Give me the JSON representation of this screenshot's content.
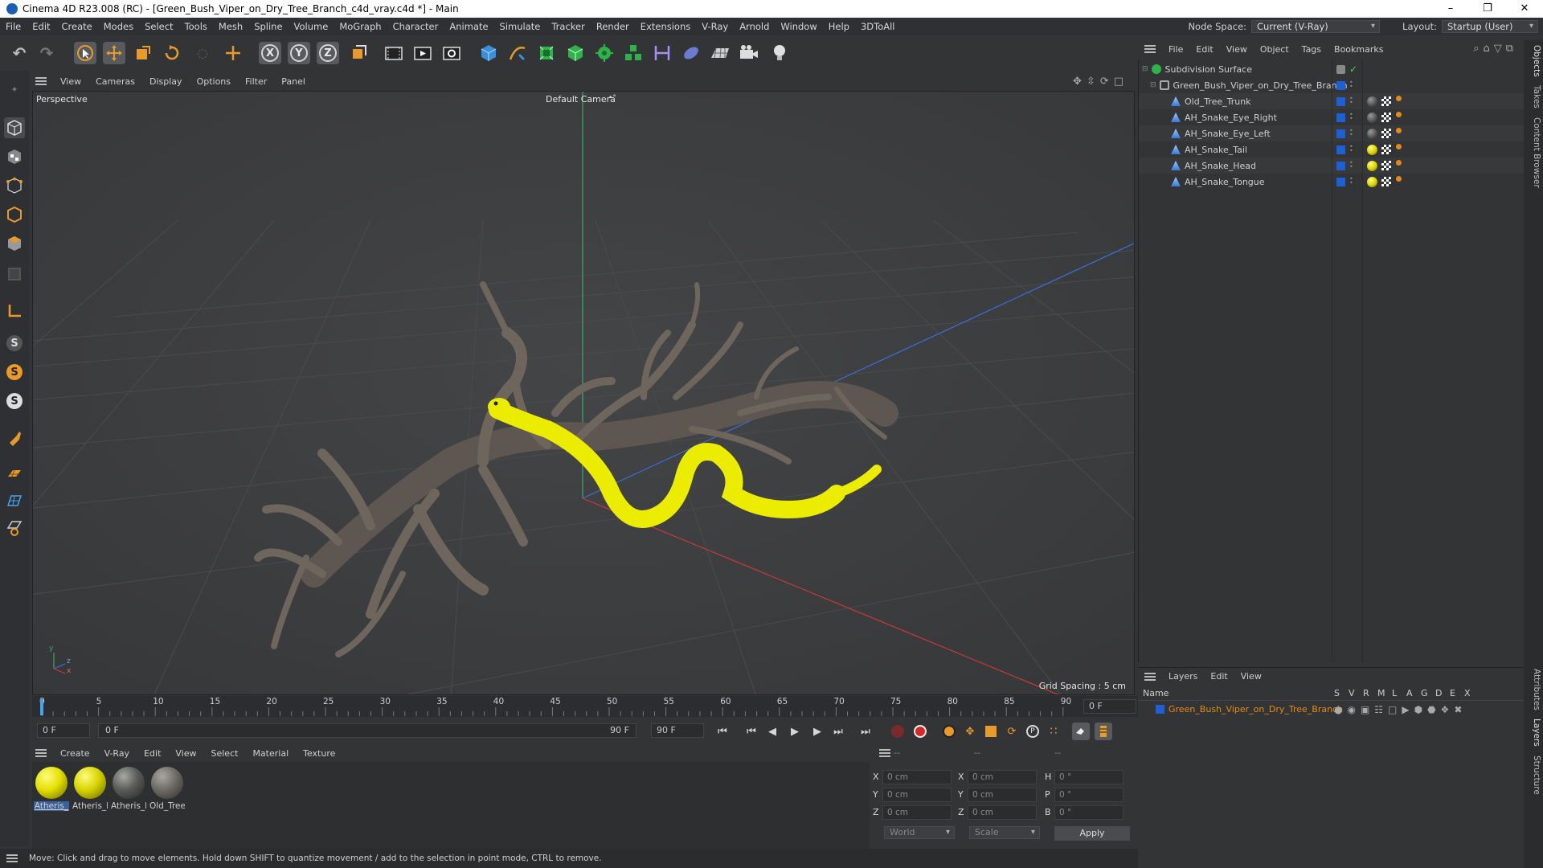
{
  "window": {
    "title": "Cinema 4D R23.008 (RC) - [Green_Bush_Viper_on_Dry_Tree_Branch_c4d_vray.c4d *] - Main",
    "minimize": "–",
    "maximize": "❐",
    "close": "✕"
  },
  "menu": [
    "File",
    "Edit",
    "Create",
    "Modes",
    "Select",
    "Tools",
    "Mesh",
    "Spline",
    "Volume",
    "MoGraph",
    "Character",
    "Animate",
    "Simulate",
    "Tracker",
    "Render",
    "Extensions",
    "V-Ray",
    "Arnold",
    "Window",
    "Help",
    "3DToAll"
  ],
  "node_space": {
    "label": "Node Space:",
    "value": "Current (V-Ray)"
  },
  "layout": {
    "label": "Layout:",
    "value": "Startup (User)"
  },
  "toolbar": {
    "x_axis": "X",
    "y_axis": "Y",
    "z_axis": "Z"
  },
  "left_tools": {
    "snap1": "S",
    "snap2": "S",
    "snap3": "S"
  },
  "viewport": {
    "menu": [
      "View",
      "Cameras",
      "Display",
      "Options",
      "Filter",
      "Panel"
    ],
    "label": "Perspective",
    "camera": "Default Camera",
    "camera_icon": "•°",
    "grid_spacing": "Grid Spacing : 5 cm",
    "axis_y": "y",
    "axis_z": "z",
    "axis_x": "x"
  },
  "timeline": {
    "ticks": [
      "0",
      "5",
      "10",
      "15",
      "20",
      "25",
      "30",
      "35",
      "40",
      "45",
      "50",
      "55",
      "60",
      "65",
      "70",
      "75",
      "80",
      "85",
      "90"
    ],
    "current_frame": "0 F"
  },
  "transport": {
    "start_field": "0 F",
    "range_start": "0 F",
    "range_end": "90 F",
    "end_field": "90 F"
  },
  "materials": {
    "menu": [
      "Create",
      "V-Ray",
      "Edit",
      "View",
      "Select",
      "Material",
      "Texture"
    ],
    "items": [
      {
        "name": "Atheris_",
        "color": "#e4e000",
        "selected": true
      },
      {
        "name": "Atheris_I",
        "color": "#d8d400",
        "selected": false
      },
      {
        "name": "Atheris_I",
        "color": "#5a5a58",
        "selected": false
      },
      {
        "name": "Old_Tree",
        "color": "#6e6a66",
        "selected": false
      }
    ]
  },
  "coordinates": {
    "headers": [
      "--",
      "--",
      "--"
    ],
    "rows": [
      {
        "l1": "X",
        "v1": "0 cm",
        "l2": "X",
        "v2": "0 cm",
        "l3": "H",
        "v3": "0 °"
      },
      {
        "l1": "Y",
        "v1": "0 cm",
        "l2": "Y",
        "v2": "0 cm",
        "l3": "P",
        "v3": "0 °"
      },
      {
        "l1": "Z",
        "v1": "0 cm",
        "l2": "Z",
        "v2": "0 cm",
        "l3": "B",
        "v3": "0 °"
      }
    ],
    "mode_world": "World",
    "mode_scale": "Scale",
    "apply": "Apply"
  },
  "status": "Move: Click and drag to move elements. Hold down SHIFT to quantize movement / add to the selection in point mode, CTRL to remove.",
  "object_manager": {
    "menu": [
      "File",
      "Edit",
      "View",
      "Object",
      "Tags",
      "Bookmarks"
    ],
    "objects": [
      {
        "name": "Subdivision Surface",
        "level": 0
      },
      {
        "name": "Green_Bush_Viper_on_Dry_Tree_Branch",
        "level": 1
      },
      {
        "name": "Old_Tree_Trunk",
        "level": 2,
        "tag_color": "#555555"
      },
      {
        "name": "AH_Snake_Eye_Right",
        "level": 2,
        "tag_color": "#555555"
      },
      {
        "name": "AH_Snake_Eye_Left",
        "level": 2,
        "tag_color": "#555555"
      },
      {
        "name": "AH_Snake_Tail",
        "level": 2,
        "tag_color": "#d6d200"
      },
      {
        "name": "AH_Snake_Head",
        "level": 2,
        "tag_color": "#d6d200"
      },
      {
        "name": "AH_Snake_Tongue",
        "level": 2,
        "tag_color": "#d6d200"
      }
    ]
  },
  "layers": {
    "menu": [
      "Layers",
      "Edit",
      "View"
    ],
    "header_name": "Name",
    "header_cols": [
      "S",
      "V",
      "R",
      "M",
      "L",
      "A",
      "G",
      "D",
      "E",
      "X"
    ],
    "layer_name": "Green_Bush_Viper_on_Dry_Tree_Branch",
    "layer_color": "#e58a1a"
  },
  "right_tabs": [
    "Objects",
    "Takes",
    "Content Browser",
    "Attributes",
    "Layers",
    "Structure"
  ]
}
